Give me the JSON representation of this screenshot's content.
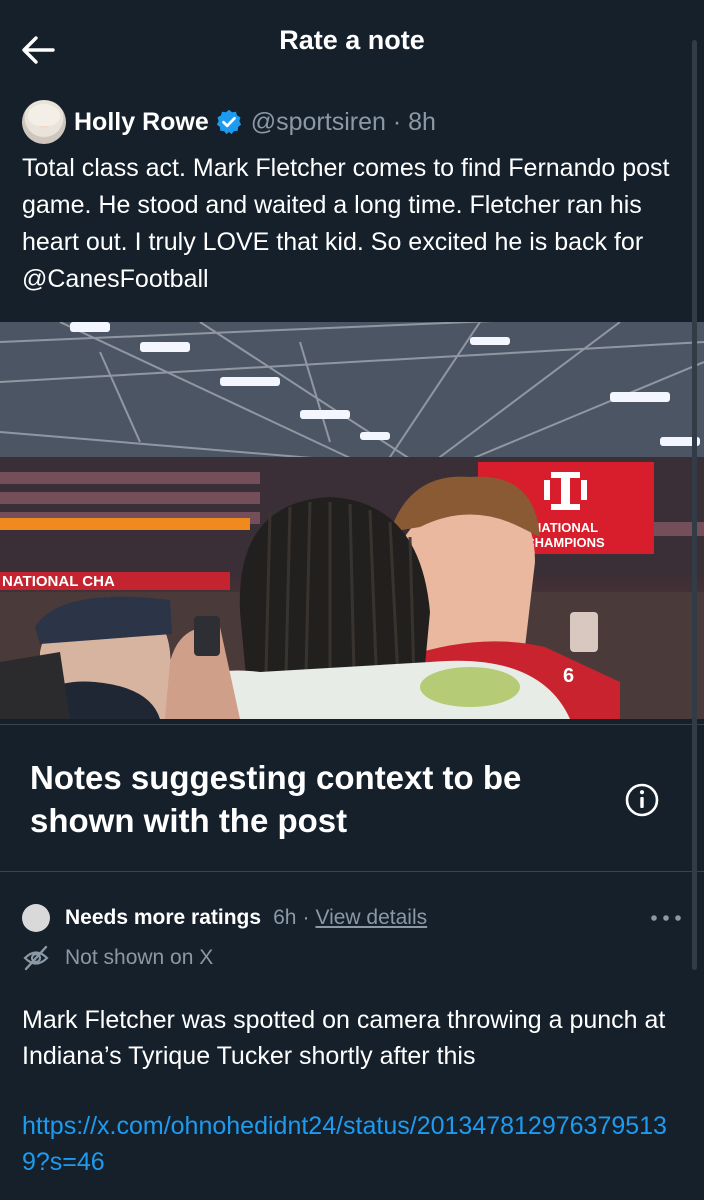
{
  "header": {
    "title": "Rate a note",
    "back_icon": "arrow-left-icon"
  },
  "tweet": {
    "author_name": "Holly Rowe",
    "handle_time": "@sportsiren · 8h",
    "verified_icon": "verified-badge-icon",
    "text": "Total class act. Mark Fletcher comes to find Fernando post game. He stood and waited a long time. Fletcher ran his heart out. I truly LOVE that kid. So excited he is back for @CanesFootball",
    "photo": {
      "banner_line1": "NATIONAL",
      "banner_line2": "CHAMPIONS",
      "ribbon_left": "NATIONAL CHA",
      "jersey_number": "6"
    }
  },
  "notes_section": {
    "title": "Notes suggesting context to be shown with the post",
    "info_icon": "info-icon"
  },
  "note": {
    "status": "Needs more ratings",
    "age": "6h",
    "separator": "·",
    "view_details": "View details",
    "visibility": "Not shown on X",
    "body": "Mark Fletcher was spotted on camera throwing a punch at Indiana’s Tyrique Tucker shortly after this",
    "link": "https://x.com/ohnohedidnt24/status/2013478129763795139?s=46",
    "more_icon": "more-horizontal-icon"
  },
  "colors": {
    "background": "#15202b",
    "link": "#1d9bf0",
    "verified": "#1d9bf0",
    "secondary_text": "#8b98a5",
    "indiana_red": "#d81e2c"
  }
}
